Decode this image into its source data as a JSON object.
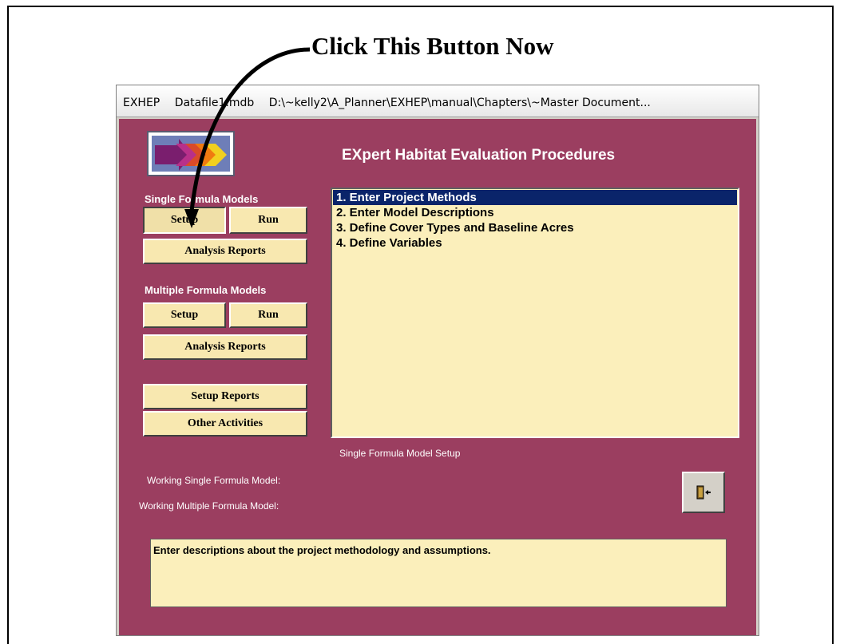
{
  "callout": {
    "text": "Click This Button Now"
  },
  "titlebar": {
    "app": "EXHEP",
    "file": "Datafile1.mdb",
    "path": "D:\\~kelly2\\A_Planner\\EXHEP\\manual\\Chapters\\~Master Document..."
  },
  "app": {
    "title": "EXpert Habitat Evaluation Procedures",
    "single": {
      "label": "Single Formula Models",
      "setup": "Setup",
      "run": "Run",
      "reports": "Analysis Reports"
    },
    "multiple": {
      "label": "Multiple Formula Models",
      "setup": "Setup",
      "run": "Run",
      "reports": "Analysis Reports"
    },
    "setup_reports": "Setup Reports",
    "other_activities": "Other Activities",
    "list_items": [
      "1. Enter Project Methods",
      "2. Enter Model Descriptions",
      "3. Define Cover Types and Baseline Acres",
      "4. Define Variables"
    ],
    "list_caption": "Single Formula Model Setup",
    "working_single": "Working Single Formula Model:",
    "working_multiple": "Working Multiple Formula Model:",
    "description": "Enter descriptions about the project methodology and assumptions.",
    "exit_icon": "exit-door-icon"
  },
  "colors": {
    "app_background": "#9b3e60",
    "button_background": "#f8e8b0",
    "list_background": "#fbefbb",
    "selection": "#0a246a"
  }
}
